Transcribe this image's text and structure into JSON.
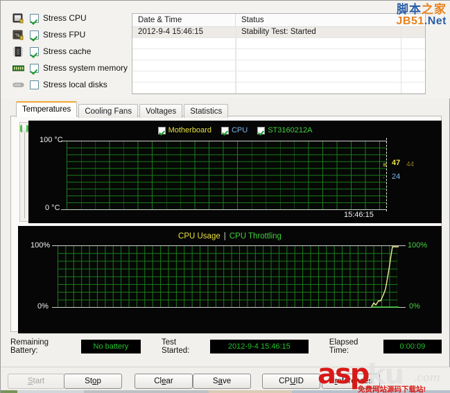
{
  "stress_options": [
    {
      "label": "Stress CPU",
      "checked": true,
      "icon": "cpu-chip-icon"
    },
    {
      "label": "Stress FPU",
      "checked": true,
      "icon": "fpu-percent-icon"
    },
    {
      "label": "Stress cache",
      "checked": true,
      "icon": "cache-chip-icon"
    },
    {
      "label": "Stress system memory",
      "checked": true,
      "icon": "memory-stick-icon"
    },
    {
      "label": "Stress local disks",
      "checked": false,
      "icon": "hard-disk-icon"
    }
  ],
  "log_table": {
    "columns": [
      "Date & Time",
      "Status"
    ],
    "rows": [
      {
        "date": "2012-9-4 15:46:15",
        "status": "Stability Test: Started"
      },
      {
        "date": "",
        "status": ""
      },
      {
        "date": "",
        "status": ""
      },
      {
        "date": "",
        "status": ""
      },
      {
        "date": "",
        "status": ""
      },
      {
        "date": "",
        "status": ""
      }
    ]
  },
  "tabs": [
    {
      "label": "Temperatures",
      "active": true
    },
    {
      "label": "Cooling Fans",
      "active": false
    },
    {
      "label": "Voltages",
      "active": false
    },
    {
      "label": "Statistics",
      "active": false
    }
  ],
  "chart_data": [
    {
      "type": "line",
      "title": "Temperatures",
      "ylabel": "",
      "xlabel": "",
      "ylim": [
        0,
        100
      ],
      "y_ticks": [
        "0 °C",
        "100 °C"
      ],
      "grid": true,
      "legend_position": "top-center",
      "x_axis_label": "15:46:15",
      "series": [
        {
          "name": "Motherboard",
          "color": "#e8e23c",
          "checked": true,
          "current": 47,
          "label": "47"
        },
        {
          "name": "CPU",
          "color": "#6ea8e8",
          "checked": true,
          "current": 24,
          "label": "24"
        },
        {
          "name": "ST3160212A",
          "color": "#3fd13f",
          "checked": true,
          "current": 44,
          "label": "44"
        }
      ],
      "secondary_label": {
        "text": "44",
        "color": "#8a7a22"
      }
    },
    {
      "type": "line",
      "title_parts": [
        "CPU Usage",
        "CPU Throttling"
      ],
      "ylim": [
        0,
        100
      ],
      "y_ticks_left": [
        "0%",
        "100%"
      ],
      "y_ticks_right": [
        "0%",
        "100%"
      ],
      "grid": true,
      "series": [
        {
          "name": "CPU Usage",
          "color": "#f0ef9a",
          "values": [
            0,
            0,
            4,
            3,
            9,
            8,
            14,
            22,
            37,
            58,
            76,
            92,
            100,
            100
          ]
        },
        {
          "name": "CPU Throttling",
          "color": "#3fd13f",
          "values": [
            0,
            0,
            0,
            0,
            0,
            0,
            0,
            0,
            0,
            0,
            0,
            0,
            0,
            0
          ]
        }
      ]
    }
  ],
  "status_bar": {
    "battery_label": "Remaining Battery:",
    "battery_value": "No battery",
    "started_label": "Test Started:",
    "started_value": "2012-9-4 15:46:15",
    "elapsed_label": "Elapsed Time:",
    "elapsed_value": "0:00:09"
  },
  "buttons": [
    {
      "label": "Start",
      "mnemonic": "S",
      "disabled": true
    },
    {
      "label": "Stop",
      "mnemonic": "o",
      "disabled": false
    },
    {
      "label": "Clear",
      "mnemonic": "e",
      "disabled": false
    },
    {
      "label": "Save",
      "mnemonic": "a",
      "disabled": false
    },
    {
      "label": "CPUID",
      "mnemonic": "U",
      "disabled": false
    },
    {
      "label": "Preferences",
      "mnemonic": "r",
      "disabled": false
    }
  ],
  "watermarks": {
    "top_cn_1": "脚本",
    "top_cn_2": "之家",
    "top_en_1": "JB51",
    "top_en_2": ".Net",
    "bottom_1": "asp",
    "bottom_2": "ku",
    "bottom_3": ".com",
    "bottom_sub": "免费网站源码下载站!"
  }
}
